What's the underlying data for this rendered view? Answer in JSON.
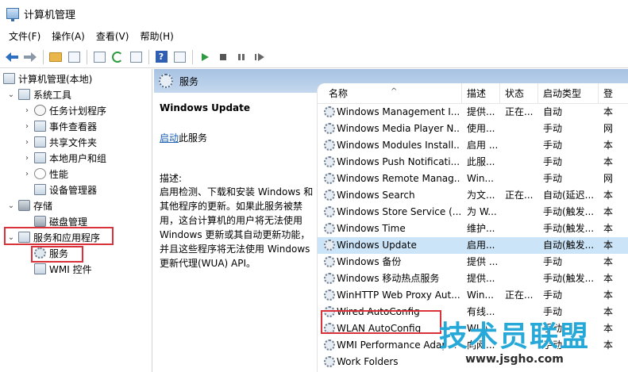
{
  "window": {
    "title": "计算机管理"
  },
  "menu": [
    {
      "label": "文件(F)"
    },
    {
      "label": "操作(A)"
    },
    {
      "label": "查看(V)"
    },
    {
      "label": "帮助(H)"
    }
  ],
  "tree": {
    "items": [
      {
        "label": "计算机管理(本地)",
        "icon": "computer-icon",
        "expanded": true
      },
      {
        "label": "系统工具",
        "icon": "tools-icon",
        "expanded": true
      },
      {
        "label": "任务计划程序",
        "icon": "clock-icon"
      },
      {
        "label": "事件查看器",
        "icon": "event-viewer-icon"
      },
      {
        "label": "共享文件夹",
        "icon": "shared-folder-icon"
      },
      {
        "label": "本地用户和组",
        "icon": "users-icon"
      },
      {
        "label": "性能",
        "icon": "performance-icon"
      },
      {
        "label": "设备管理器",
        "icon": "device-manager-icon"
      },
      {
        "label": "存储",
        "icon": "storage-icon",
        "expanded": true
      },
      {
        "label": "磁盘管理",
        "icon": "disk-icon"
      },
      {
        "label": "服务和应用程序",
        "icon": "services-apps-icon",
        "expanded": true
      },
      {
        "label": "服务",
        "icon": "services-icon",
        "selected": true
      },
      {
        "label": "WMI 控件",
        "icon": "wmi-icon"
      }
    ]
  },
  "panel": {
    "title": "服务",
    "selected_service": "Windows Update",
    "start_link": "启动",
    "start_suffix": "此服务",
    "desc_label": "描述:",
    "description": "启用检测、下载和安装 Windows 和其他程序的更新。如果此服务被禁用，这台计算机的用户将无法使用 Windows 更新或其自动更新功能，并且这些程序将无法使用 Windows 更新代理(WUA) API。"
  },
  "columns": {
    "name": "名称",
    "description": "描述",
    "status": "状态",
    "startup": "启动类型",
    "logon": "登"
  },
  "services": [
    {
      "name": "Windows Management I...",
      "description": "提供...",
      "status": "正在...",
      "startup": "自动",
      "logon": "本"
    },
    {
      "name": "Windows Media Player N...",
      "description": "使用...",
      "status": "",
      "startup": "手动",
      "logon": "网"
    },
    {
      "name": "Windows Modules Install...",
      "description": "启用 ...",
      "status": "",
      "startup": "手动",
      "logon": "本"
    },
    {
      "name": "Windows Push Notificati...",
      "description": "此服...",
      "status": "",
      "startup": "手动",
      "logon": "本"
    },
    {
      "name": "Windows Remote Manag...",
      "description": "Win...",
      "status": "",
      "startup": "手动",
      "logon": "网"
    },
    {
      "name": "Windows Search",
      "description": "为文...",
      "status": "正在...",
      "startup": "自动(延迟...",
      "logon": "本"
    },
    {
      "name": "Windows Store Service (...",
      "description": "为 W...",
      "status": "",
      "startup": "手动(触发...",
      "logon": "本"
    },
    {
      "name": "Windows Time",
      "description": "维护...",
      "status": "",
      "startup": "手动(触发...",
      "logon": "本"
    },
    {
      "name": "Windows Update",
      "description": "启用...",
      "status": "",
      "startup": "自动(触发...",
      "logon": "本",
      "selected": true
    },
    {
      "name": "Windows 备份",
      "description": "提供 ...",
      "status": "",
      "startup": "手动",
      "logon": "本"
    },
    {
      "name": "Windows 移动热点服务",
      "description": "提供...",
      "status": "",
      "startup": "手动(触发...",
      "logon": "本"
    },
    {
      "name": "WinHTTP Web Proxy Aut...",
      "description": "Win...",
      "status": "正在...",
      "startup": "手动",
      "logon": "本"
    },
    {
      "name": "Wired AutoConfig",
      "description": "有线...",
      "status": "",
      "startup": "手动",
      "logon": "本"
    },
    {
      "name": "WLAN AutoConfig",
      "description": "WLA...",
      "status": "",
      "startup": "手动",
      "logon": "本"
    },
    {
      "name": "WMI Performance Adap...",
      "description": "向网...",
      "status": "",
      "startup": "手动",
      "logon": "本"
    },
    {
      "name": "Work Folders",
      "description": "",
      "status": "",
      "startup": "",
      "logon": ""
    }
  ],
  "watermark": {
    "text": "技术员联盟",
    "url": "www.jsgho.com"
  },
  "colors": {
    "header_bar": "#b7cfe9",
    "selected_row": "#cce4f7",
    "highlight_box": "#d9323a",
    "link": "#1a5fb4",
    "watermark": "#26a8d8"
  }
}
